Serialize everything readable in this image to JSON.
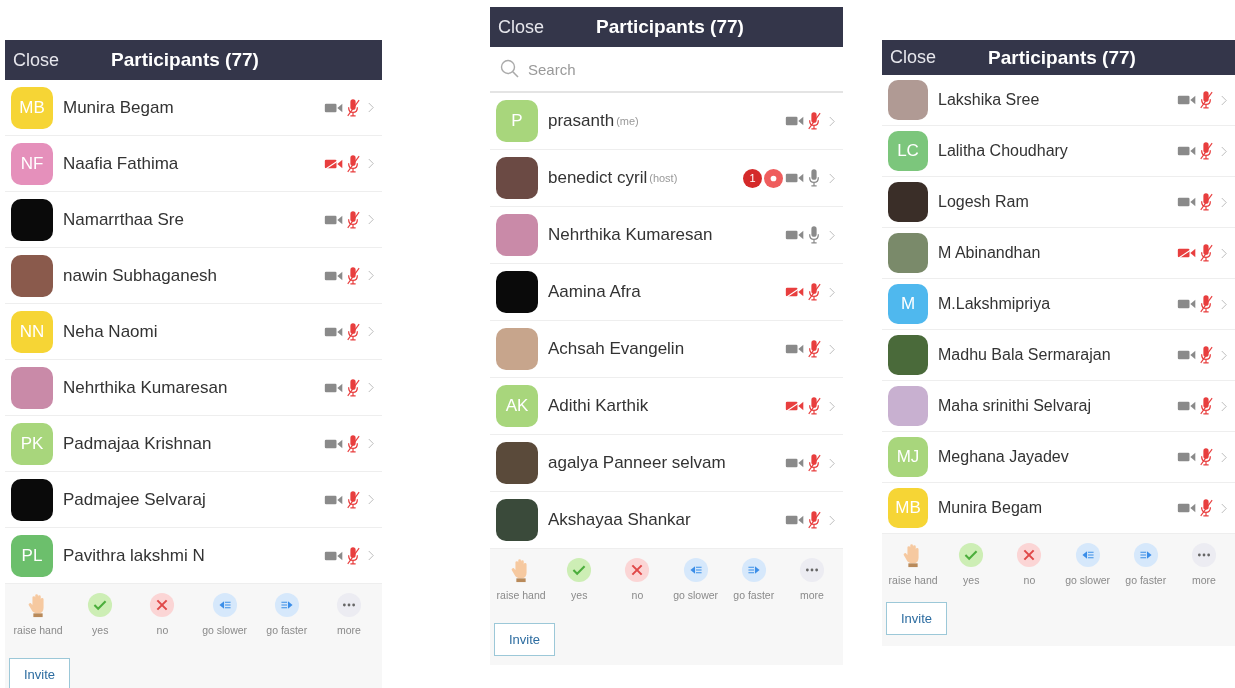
{
  "panels": [
    {
      "close": "Close",
      "title": "Participants (77)",
      "participants": [
        {
          "name": "Munira Begam",
          "avatar": {
            "kind": "initials",
            "initials": "MB",
            "color": "#f6d535"
          },
          "video_blocked": false,
          "muted": true
        },
        {
          "name": "Naafia Fathima",
          "avatar": {
            "kind": "initials",
            "initials": "NF",
            "color": "#e590bb"
          },
          "video_blocked": true,
          "muted": true
        },
        {
          "name": "Namarrthaa Sre",
          "avatar": {
            "kind": "photo",
            "color": "#0a0a0a"
          },
          "video_blocked": false,
          "muted": true
        },
        {
          "name": "nawin Subhaganesh",
          "avatar": {
            "kind": "photo",
            "color": "#8a5a4c"
          },
          "video_blocked": false,
          "muted": true
        },
        {
          "name": "Neha Naomi",
          "avatar": {
            "kind": "initials",
            "initials": "NN",
            "color": "#f6d535"
          },
          "video_blocked": false,
          "muted": true
        },
        {
          "name": "Nehrthika Kumaresan",
          "avatar": {
            "kind": "photo",
            "color": "#c98aa8"
          },
          "video_blocked": false,
          "muted": true
        },
        {
          "name": "Padmajaa Krishnan",
          "avatar": {
            "kind": "initials",
            "initials": "PK",
            "color": "#a8d67c"
          },
          "video_blocked": false,
          "muted": true
        },
        {
          "name": "Padmajee Selvaraj",
          "avatar": {
            "kind": "photo",
            "color": "#0a0a0a"
          },
          "video_blocked": false,
          "muted": true
        },
        {
          "name": "Pavithra lakshmi N",
          "avatar": {
            "kind": "initials",
            "initials": "PL",
            "color": "#6cbf6c"
          },
          "video_blocked": false,
          "muted": true
        }
      ],
      "reactions": [
        {
          "kind": "hand",
          "label": "raise hand"
        },
        {
          "kind": "yes",
          "label": "yes"
        },
        {
          "kind": "no",
          "label": "no"
        },
        {
          "kind": "slower",
          "label": "go slower"
        },
        {
          "kind": "faster",
          "label": "go faster"
        },
        {
          "kind": "more",
          "label": "more"
        }
      ],
      "invite": "Invite"
    },
    {
      "close": "Close",
      "title": "Participants (77)",
      "search": {
        "placeholder": "Search"
      },
      "participants": [
        {
          "name": "prasanth",
          "tag": "(me)",
          "avatar": {
            "kind": "initials",
            "initials": "P",
            "color": "#a8d67c"
          },
          "video_blocked": false,
          "muted": true
        },
        {
          "name": "benedict cyril",
          "tag": "(host)",
          "badge": "1",
          "recording": true,
          "avatar": {
            "kind": "photo",
            "color": "#6b4a44"
          },
          "video_blocked": false,
          "muted": false
        },
        {
          "name": "Nehrthika Kumaresan",
          "avatar": {
            "kind": "photo",
            "color": "#c98aa8"
          },
          "video_blocked": false,
          "muted": false
        },
        {
          "name": "Aamina Afra",
          "avatar": {
            "kind": "photo",
            "color": "#0a0a0a"
          },
          "video_blocked": true,
          "muted": true
        },
        {
          "name": "Achsah Evangelin",
          "avatar": {
            "kind": "photo",
            "color": "#c7a58c"
          },
          "video_blocked": false,
          "muted": true
        },
        {
          "name": "Adithi Karthik",
          "avatar": {
            "kind": "initials",
            "initials": "AK",
            "color": "#a8d67c"
          },
          "video_blocked": true,
          "muted": true
        },
        {
          "name": "agalya Panneer selvam",
          "avatar": {
            "kind": "photo",
            "color": "#5a4a3a"
          },
          "video_blocked": false,
          "muted": true
        },
        {
          "name": "Akshayaa Shankar",
          "avatar": {
            "kind": "photo",
            "color": "#3a4a3a"
          },
          "video_blocked": false,
          "muted": true
        }
      ],
      "reactions": [
        {
          "kind": "hand",
          "label": "raise hand"
        },
        {
          "kind": "yes",
          "label": "yes"
        },
        {
          "kind": "no",
          "label": "no"
        },
        {
          "kind": "slower",
          "label": "go slower"
        },
        {
          "kind": "faster",
          "label": "go faster"
        },
        {
          "kind": "more",
          "label": "more"
        }
      ],
      "invite": "Invite"
    },
    {
      "close": "Close",
      "title": "Participants (77)",
      "participants": [
        {
          "name": "Lakshika Sree",
          "avatar": {
            "kind": "photo",
            "color": "#b09a94"
          },
          "video_blocked": false,
          "muted": true
        },
        {
          "name": "Lalitha Choudhary",
          "avatar": {
            "kind": "initials",
            "initials": "LC",
            "color": "#7cc67c"
          },
          "video_blocked": false,
          "muted": true
        },
        {
          "name": "Logesh Ram",
          "avatar": {
            "kind": "photo",
            "color": "#3a2e28"
          },
          "video_blocked": false,
          "muted": true
        },
        {
          "name": "M Abinandhan",
          "avatar": {
            "kind": "photo",
            "color": "#7a8a6a"
          },
          "video_blocked": true,
          "muted": true
        },
        {
          "name": "M.Lakshmipriya",
          "avatar": {
            "kind": "initials",
            "initials": "M",
            "color": "#4fb8ee"
          },
          "video_blocked": false,
          "muted": true
        },
        {
          "name": "Madhu Bala Sermarajan",
          "avatar": {
            "kind": "photo",
            "color": "#4a6a3a"
          },
          "video_blocked": false,
          "muted": true
        },
        {
          "name": "Maha srinithi Selvaraj",
          "avatar": {
            "kind": "photo",
            "color": "#c8b0d0"
          },
          "video_blocked": false,
          "muted": true
        },
        {
          "name": "Meghana Jayadev",
          "avatar": {
            "kind": "initials",
            "initials": "MJ",
            "color": "#a8d67c"
          },
          "video_blocked": false,
          "muted": true
        },
        {
          "name": "Munira Begam",
          "avatar": {
            "kind": "initials",
            "initials": "MB",
            "color": "#f6d535"
          },
          "video_blocked": false,
          "muted": true
        }
      ],
      "reactions": [
        {
          "kind": "hand",
          "label": "raise hand"
        },
        {
          "kind": "yes",
          "label": "yes"
        },
        {
          "kind": "no",
          "label": "no"
        },
        {
          "kind": "slower",
          "label": "go slower"
        },
        {
          "kind": "faster",
          "label": "go faster"
        },
        {
          "kind": "more",
          "label": "more"
        }
      ],
      "invite": "Invite"
    }
  ]
}
